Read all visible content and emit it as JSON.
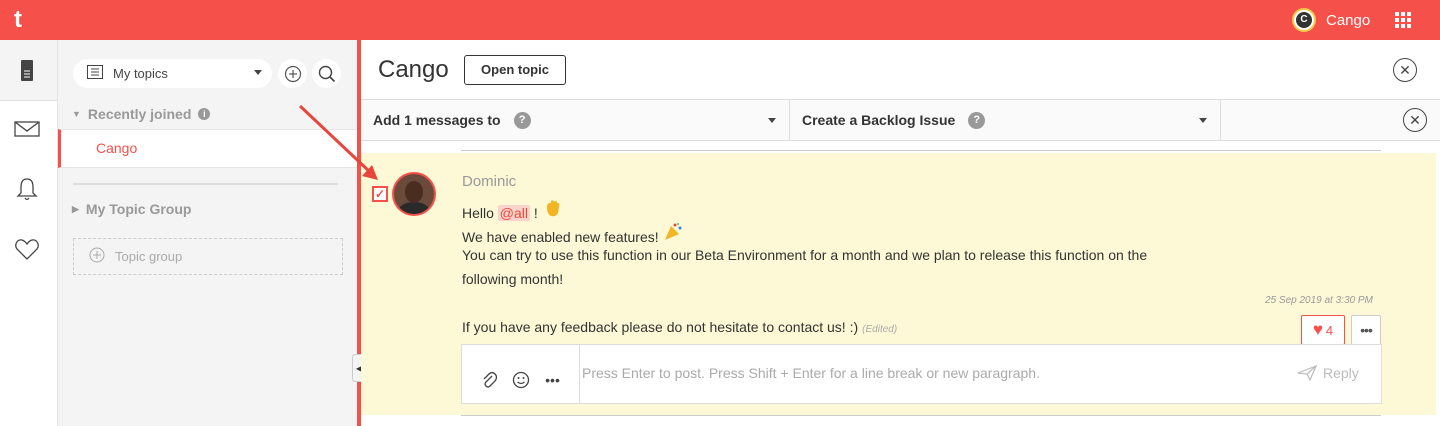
{
  "app": {
    "logo": "t"
  },
  "topbar": {
    "org_name": "Cango",
    "org_logo_letter": "C"
  },
  "sidebar": {
    "topic_selector": "My topics",
    "sections": [
      {
        "label": "Recently joined",
        "info": "i",
        "topics": [
          "Cango"
        ]
      },
      {
        "label": "My Topic Group"
      }
    ],
    "add_group_label": "Topic group"
  },
  "main": {
    "title": "Cango",
    "open_topic_label": "Open topic",
    "action_bar": {
      "add_messages_label": "Add 1 messages to",
      "add_messages_help": "?",
      "backlog_label": "Create a Backlog Issue",
      "backlog_help": "?"
    },
    "message": {
      "author": "Dominic",
      "hello": "Hello",
      "mention": "@all",
      "exclaim": "!",
      "line2": "We have enabled new features!",
      "line3": "You can try to use this function in our Beta Environment for a month and we plan to release this function on the",
      "line4": "following month!",
      "timestamp": "25 Sep 2019 at 3:30 PM",
      "line5": "If you have any feedback please do not hesitate to contact us! :)",
      "edited": "(Edited)",
      "reaction_count": "4",
      "more": "•••"
    },
    "composer": {
      "placeholder": "Press Enter to post. Press Shift + Enter for a line break or new paragraph.",
      "reply_label": "Reply",
      "more": "•••"
    }
  },
  "colors": {
    "brand": "#f5504a",
    "highlight": "#fdf9d6"
  },
  "icons": [
    "document-icon",
    "mail-icon",
    "bell-icon",
    "heart-icon",
    "list-icon",
    "plus-icon",
    "search-icon",
    "close-icon",
    "paperclip-icon",
    "smiley-icon",
    "send-icon",
    "wave-emoji",
    "party-emoji",
    "grid-icon"
  ]
}
